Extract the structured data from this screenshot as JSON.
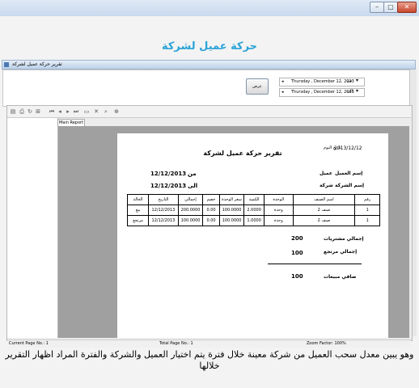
{
  "window": {
    "min_label": "–",
    "max_label": "▢",
    "close_label": "✕"
  },
  "heading": "حركة عميل لشركة",
  "panel": {
    "title": "تقرير حركة عميل لشركة"
  },
  "params": {
    "from_date": "Thursday , December 12, 2013",
    "to_date": "Thursday , December 12, 2013",
    "from_label": "من",
    "to_label": "الى",
    "show_button": "عرض"
  },
  "viewer": {
    "tab": "Main Report",
    "status": {
      "current_page": "Current Page No.: 1",
      "total_page": "Total Page No.: 1",
      "zoom": "Zoom Factor: 100%"
    }
  },
  "report": {
    "date_label": "تاريخ اليوم",
    "date_value": "2013/12/12",
    "title": "تقرير حركة عميل لشركة",
    "customer_label": "إسم العميل",
    "customer_value": "عميل",
    "company_label": "إسم الشركة",
    "company_value": "شركة",
    "from_label": "من",
    "from_value": "12/12/2013",
    "to_label": "الى",
    "to_value": "12/12/2013",
    "columns": [
      "رقم",
      "اسم الصنف",
      "الوحدة",
      "الكمية",
      "سعر الوحدة",
      "خصم",
      "إجمالي",
      "التاريخ",
      "الحالة"
    ],
    "rows": [
      [
        "1",
        "صنف 2",
        "وحدة",
        "2.0000",
        "100.0000",
        "0.00",
        "200.0000",
        "12/12/2013",
        "بيع"
      ],
      [
        "1",
        "صنف 2",
        "وحدة",
        "1.0000",
        "100.0000",
        "0.00",
        "100.0000",
        "12/12/2013",
        "مرتجع"
      ]
    ],
    "total_purchases_label": "إجمالي مشتريات",
    "total_purchases_value": "200",
    "total_returns_label": "إجمالي مرتجع",
    "total_returns_value": "100",
    "net_sales_label": "صافي مبيعات",
    "net_sales_value": "100"
  },
  "caption": "وهو يبين معدل سحب العميل من شركة معينة خلال فترة يتم اختيار العميل والشركة والفترة المراد اظهار التقرير خلالها"
}
